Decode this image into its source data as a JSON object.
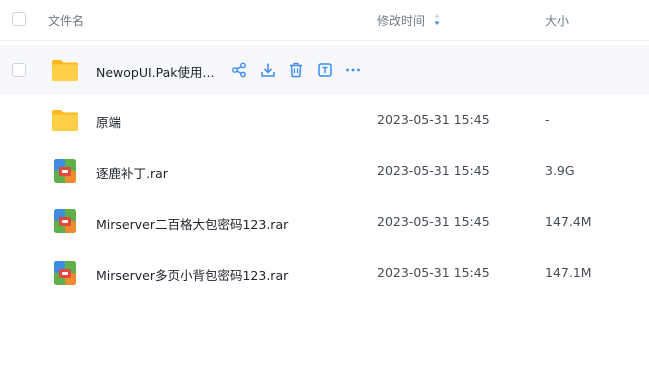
{
  "header": {
    "name_col": "文件名",
    "modified_col": "修改时间",
    "size_col": "大小"
  },
  "colors": {
    "accent": "#3a8cf0",
    "folder": "#ffc53d",
    "hover_row": "#f6f8fc"
  },
  "files": [
    {
      "name": "NewopUI.Pak使用...",
      "type": "folder-icon",
      "modified": "",
      "size": "",
      "actions": [
        "share-icon",
        "download-icon",
        "delete-icon",
        "rename-icon",
        "more-icon"
      ]
    },
    {
      "name": "原端",
      "type": "folder-icon",
      "modified": "2023-05-31 15:45",
      "size": "-"
    },
    {
      "name": "逐鹿补丁.rar",
      "type": "archive-icon",
      "modified": "2023-05-31 15:45",
      "size": "3.9G"
    },
    {
      "name": "Mirserver二百格大包密码123.rar",
      "type": "archive-icon",
      "modified": "2023-05-31 15:45",
      "size": "147.4M"
    },
    {
      "name": "Mirserver多页小背包密码123.rar",
      "type": "archive-icon",
      "modified": "2023-05-31 15:45",
      "size": "147.1M"
    }
  ]
}
